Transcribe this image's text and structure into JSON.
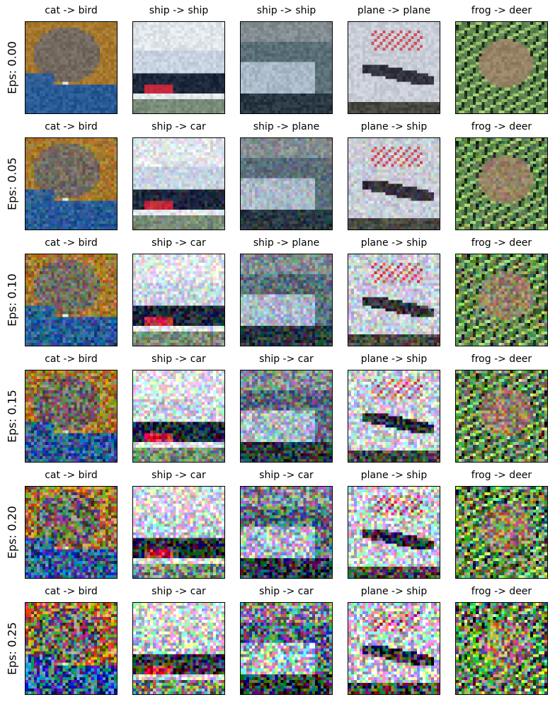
{
  "figure": {
    "rows": [
      {
        "label": "Eps: 0.00",
        "eps": 0.0,
        "titles": [
          "cat -> bird",
          "ship -> ship",
          "ship -> ship",
          "plane -> plane",
          "frog -> deer"
        ]
      },
      {
        "label": "Eps: 0.05",
        "eps": 0.05,
        "titles": [
          "cat -> bird",
          "ship -> car",
          "ship -> plane",
          "plane -> ship",
          "frog -> deer"
        ]
      },
      {
        "label": "Eps: 0.10",
        "eps": 0.1,
        "titles": [
          "cat -> bird",
          "ship -> car",
          "ship -> plane",
          "plane -> ship",
          "frog -> deer"
        ]
      },
      {
        "label": "Eps: 0.15",
        "eps": 0.15,
        "titles": [
          "cat -> bird",
          "ship -> car",
          "ship -> car",
          "plane -> ship",
          "frog -> deer"
        ]
      },
      {
        "label": "Eps: 0.20",
        "eps": 0.2,
        "titles": [
          "cat -> bird",
          "ship -> car",
          "ship -> car",
          "plane -> ship",
          "frog -> deer"
        ]
      },
      {
        "label": "Eps: 0.25",
        "eps": 0.25,
        "titles": [
          "cat -> bird",
          "ship -> car",
          "ship -> car",
          "plane -> ship",
          "frog -> deer"
        ]
      }
    ],
    "images": [
      {
        "name": "cat-image",
        "subject": "cat"
      },
      {
        "name": "ship-image-1",
        "subject": "ship"
      },
      {
        "name": "ship-image-2",
        "subject": "ship2"
      },
      {
        "name": "plane-image",
        "subject": "plane"
      },
      {
        "name": "frog-image",
        "subject": "frog"
      }
    ]
  }
}
